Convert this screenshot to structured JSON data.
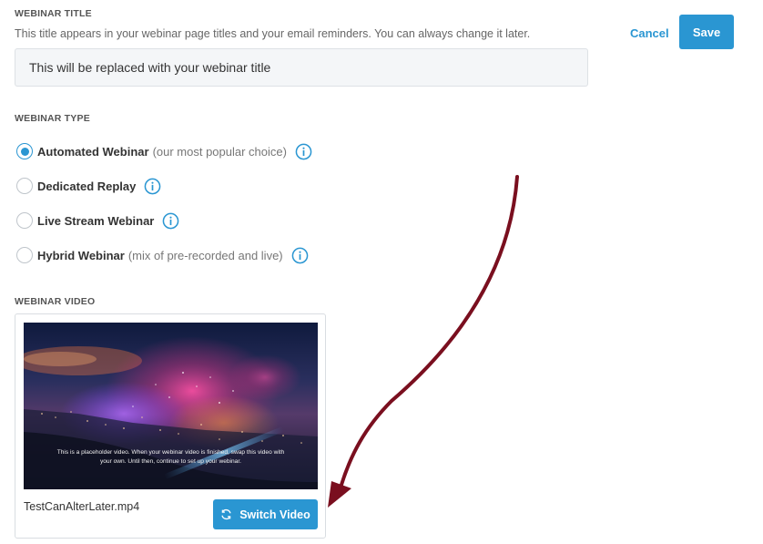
{
  "title_section": {
    "label": "WEBINAR TITLE",
    "help": "This title appears in your webinar page titles and your email reminders. You can always change it later.",
    "input_value": "This will be replaced with your webinar title"
  },
  "actions": {
    "cancel_label": "Cancel",
    "save_label": "Save"
  },
  "type_section": {
    "label": "WEBINAR TYPE",
    "options": [
      {
        "label": "Automated Webinar",
        "note": "(our most popular choice)",
        "checked": true
      },
      {
        "label": "Dedicated Replay",
        "note": "",
        "checked": false
      },
      {
        "label": "Live Stream Webinar",
        "note": "",
        "checked": false
      },
      {
        "label": "Hybrid Webinar",
        "note": "(mix of pre-recorded and live)",
        "checked": false
      }
    ]
  },
  "video_section": {
    "label": "WEBINAR VIDEO",
    "caption": "This is a placeholder video. When your webinar video is finished, swap this video with your own. Until then, continue to set up your webinar.",
    "file_name": "TestCanAlterLater.mp4",
    "switch_label": "Switch Video"
  },
  "colors": {
    "accent": "#2a96d2",
    "annotation_arrow": "#7a0f1f"
  },
  "icons": [
    "info-icon",
    "refresh-icon",
    "radio-icon"
  ]
}
